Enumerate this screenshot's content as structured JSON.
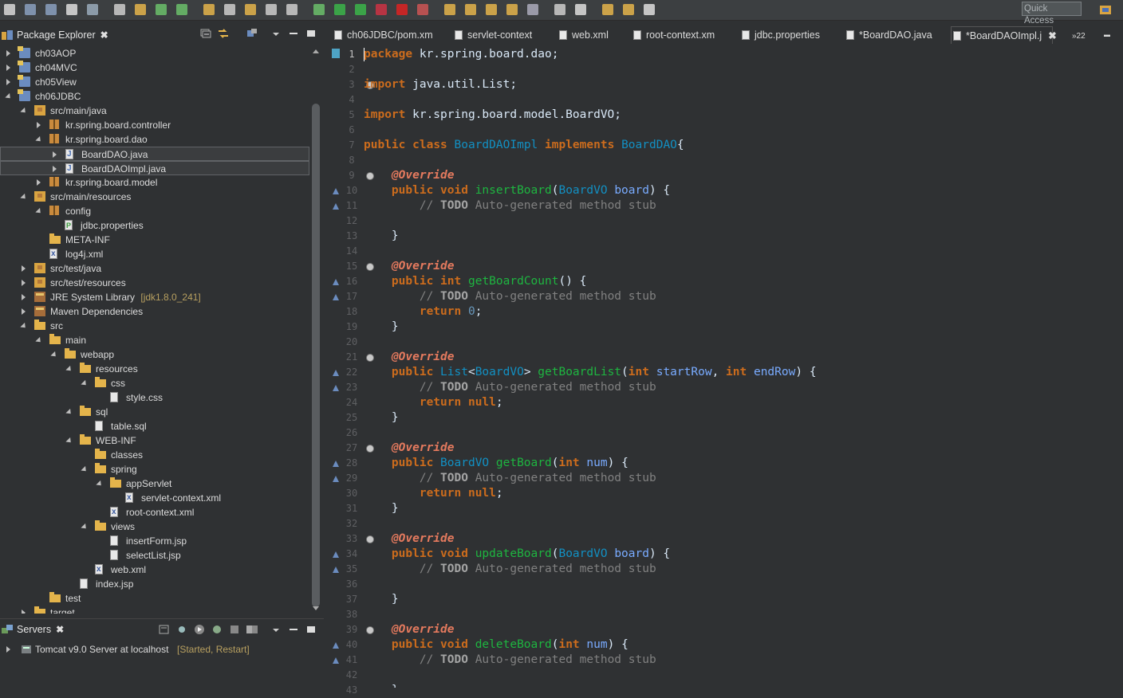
{
  "toolbar": {
    "quick_access": "Quick Access"
  },
  "package_explorer": {
    "title": "Package Explorer",
    "tree": [
      {
        "label": "ch03AOP",
        "indent": 0,
        "twisty": "collapsed",
        "icon": "project-icon"
      },
      {
        "label": "ch04MVC",
        "indent": 0,
        "twisty": "collapsed",
        "icon": "project-icon"
      },
      {
        "label": "ch05View",
        "indent": 0,
        "twisty": "collapsed",
        "icon": "project-icon"
      },
      {
        "label": "ch06JDBC",
        "indent": 0,
        "twisty": "expanded",
        "icon": "project-icon"
      },
      {
        "label": "src/main/java",
        "indent": 1,
        "twisty": "expanded",
        "icon": "source-folder-icon"
      },
      {
        "label": "kr.spring.board.controller",
        "indent": 2,
        "twisty": "collapsed",
        "icon": "package-icon"
      },
      {
        "label": "kr.spring.board.dao",
        "indent": 2,
        "twisty": "expanded",
        "icon": "package-icon"
      },
      {
        "label": "BoardDAO.java",
        "indent": 3,
        "twisty": "collapsed",
        "icon": "java-file-icon",
        "selected": true
      },
      {
        "label": "BoardDAOImpl.java",
        "indent": 3,
        "twisty": "collapsed",
        "icon": "java-file-icon",
        "selected": true
      },
      {
        "label": "kr.spring.board.model",
        "indent": 2,
        "twisty": "collapsed",
        "icon": "package-icon"
      },
      {
        "label": "src/main/resources",
        "indent": 1,
        "twisty": "expanded",
        "icon": "source-folder-icon"
      },
      {
        "label": "config",
        "indent": 2,
        "twisty": "expanded",
        "icon": "package-icon"
      },
      {
        "label": "jdbc.properties",
        "indent": 3,
        "twisty": "none",
        "icon": "properties-file-icon"
      },
      {
        "label": "META-INF",
        "indent": 2,
        "twisty": "none",
        "icon": "folder-icon"
      },
      {
        "label": "log4j.xml",
        "indent": 2,
        "twisty": "none",
        "icon": "xml-file-icon"
      },
      {
        "label": "src/test/java",
        "indent": 1,
        "twisty": "collapsed",
        "icon": "source-folder-icon"
      },
      {
        "label": "src/test/resources",
        "indent": 1,
        "twisty": "collapsed",
        "icon": "source-folder-icon"
      },
      {
        "label": "JRE System Library",
        "decoration": "[jdk1.8.0_241]",
        "indent": 1,
        "twisty": "collapsed",
        "icon": "library-icon"
      },
      {
        "label": "Maven Dependencies",
        "indent": 1,
        "twisty": "collapsed",
        "icon": "library-icon"
      },
      {
        "label": "src",
        "indent": 1,
        "twisty": "expanded",
        "icon": "folder-icon"
      },
      {
        "label": "main",
        "indent": 2,
        "twisty": "expanded",
        "icon": "folder-icon"
      },
      {
        "label": "webapp",
        "indent": 3,
        "twisty": "expanded",
        "icon": "folder-icon"
      },
      {
        "label": "resources",
        "indent": 4,
        "twisty": "expanded",
        "icon": "folder-icon"
      },
      {
        "label": "css",
        "indent": 5,
        "twisty": "expanded",
        "icon": "folder-icon"
      },
      {
        "label": "style.css",
        "indent": 6,
        "twisty": "none",
        "icon": "file-icon"
      },
      {
        "label": "sql",
        "indent": 4,
        "twisty": "expanded",
        "icon": "folder-icon"
      },
      {
        "label": "table.sql",
        "indent": 5,
        "twisty": "none",
        "icon": "file-icon"
      },
      {
        "label": "WEB-INF",
        "indent": 4,
        "twisty": "expanded",
        "icon": "folder-icon"
      },
      {
        "label": "classes",
        "indent": 5,
        "twisty": "none",
        "icon": "folder-icon"
      },
      {
        "label": "spring",
        "indent": 5,
        "twisty": "expanded",
        "icon": "folder-icon"
      },
      {
        "label": "appServlet",
        "indent": 6,
        "twisty": "expanded",
        "icon": "folder-icon"
      },
      {
        "label": "servlet-context.xml",
        "indent": 7,
        "twisty": "none",
        "icon": "xml-file-icon"
      },
      {
        "label": "root-context.xml",
        "indent": 6,
        "twisty": "none",
        "icon": "xml-file-icon"
      },
      {
        "label": "views",
        "indent": 5,
        "twisty": "expanded",
        "icon": "folder-icon"
      },
      {
        "label": "insertForm.jsp",
        "indent": 6,
        "twisty": "none",
        "icon": "file-icon"
      },
      {
        "label": "selectList.jsp",
        "indent": 6,
        "twisty": "none",
        "icon": "file-icon"
      },
      {
        "label": "web.xml",
        "indent": 5,
        "twisty": "none",
        "icon": "xml-file-icon"
      },
      {
        "label": "index.jsp",
        "indent": 4,
        "twisty": "none",
        "icon": "file-icon"
      },
      {
        "label": "test",
        "indent": 2,
        "twisty": "none",
        "icon": "folder-icon"
      },
      {
        "label": "target",
        "indent": 1,
        "twisty": "collapsed",
        "icon": "folder-icon"
      }
    ]
  },
  "servers": {
    "title": "Servers",
    "items": [
      {
        "label": "Tomcat v9.0 Server at localhost",
        "status": "[Started, Restart]"
      }
    ]
  },
  "editor": {
    "tabs": [
      {
        "label": "ch06JDBC/pom.xm",
        "active": false
      },
      {
        "label": "servlet-context",
        "active": false
      },
      {
        "label": "web.xml",
        "active": false
      },
      {
        "label": "root-context.xm",
        "active": false
      },
      {
        "label": "jdbc.properties",
        "active": false
      },
      {
        "label": "*BoardDAO.java",
        "active": false
      },
      {
        "label": "*BoardDAOImpl.j",
        "active": true
      }
    ],
    "overflow_label": "22",
    "current_line": 1,
    "code_lines": [
      [
        [
          "k",
          "package"
        ],
        [
          "tx",
          " kr.spring.board.dao;"
        ]
      ],
      [],
      [
        [
          "k",
          "import"
        ],
        [
          "tx",
          " java.util.List;"
        ]
      ],
      [],
      [
        [
          "k",
          "import"
        ],
        [
          "tx",
          " kr.spring.board.model.BoardVO;"
        ]
      ],
      [],
      [
        [
          "k",
          "public"
        ],
        [
          "tx",
          " "
        ],
        [
          "k",
          "class"
        ],
        [
          "tx",
          " "
        ],
        [
          "ty",
          "BoardDAOImpl"
        ],
        [
          "tx",
          " "
        ],
        [
          "k",
          "implements"
        ],
        [
          "tx",
          " "
        ],
        [
          "ty",
          "BoardDAO"
        ],
        [
          "tx",
          "{"
        ]
      ],
      [],
      [
        [
          "tx",
          "    "
        ],
        [
          "an",
          "@Override"
        ]
      ],
      [
        [
          "tx",
          "    "
        ],
        [
          "k",
          "public"
        ],
        [
          "tx",
          " "
        ],
        [
          "k",
          "void"
        ],
        [
          "tx",
          " "
        ],
        [
          "mt",
          "insertBoard"
        ],
        [
          "tx",
          "("
        ],
        [
          "ty",
          "BoardVO"
        ],
        [
          "tx",
          " "
        ],
        [
          "pn",
          "board"
        ],
        [
          "tx",
          ") {"
        ]
      ],
      [
        [
          "tx",
          "        "
        ],
        [
          "cm",
          "// "
        ],
        [
          "td",
          "TODO"
        ],
        [
          "cm",
          " Auto-generated method stub"
        ]
      ],
      [],
      [
        [
          "tx",
          "    }"
        ]
      ],
      [],
      [
        [
          "tx",
          "    "
        ],
        [
          "an",
          "@Override"
        ]
      ],
      [
        [
          "tx",
          "    "
        ],
        [
          "k",
          "public"
        ],
        [
          "tx",
          " "
        ],
        [
          "k",
          "int"
        ],
        [
          "tx",
          " "
        ],
        [
          "mt",
          "getBoardCount"
        ],
        [
          "tx",
          "() {"
        ]
      ],
      [
        [
          "tx",
          "        "
        ],
        [
          "cm",
          "// "
        ],
        [
          "td",
          "TODO"
        ],
        [
          "cm",
          " Auto-generated method stub"
        ]
      ],
      [
        [
          "tx",
          "        "
        ],
        [
          "k",
          "return"
        ],
        [
          "tx",
          " "
        ],
        [
          "nm",
          "0"
        ],
        [
          "tx",
          ";"
        ]
      ],
      [
        [
          "tx",
          "    }"
        ]
      ],
      [],
      [
        [
          "tx",
          "    "
        ],
        [
          "an",
          "@Override"
        ]
      ],
      [
        [
          "tx",
          "    "
        ],
        [
          "k",
          "public"
        ],
        [
          "tx",
          " "
        ],
        [
          "ty",
          "List"
        ],
        [
          "tx",
          "<"
        ],
        [
          "ty",
          "BoardVO"
        ],
        [
          "tx",
          "> "
        ],
        [
          "mt",
          "getBoardList"
        ],
        [
          "tx",
          "("
        ],
        [
          "k",
          "int"
        ],
        [
          "tx",
          " "
        ],
        [
          "pn",
          "startRow"
        ],
        [
          "tx",
          ", "
        ],
        [
          "k",
          "int"
        ],
        [
          "tx",
          " "
        ],
        [
          "pn",
          "endRow"
        ],
        [
          "tx",
          ") {"
        ]
      ],
      [
        [
          "tx",
          "        "
        ],
        [
          "cm",
          "// "
        ],
        [
          "td",
          "TODO"
        ],
        [
          "cm",
          " Auto-generated method stub"
        ]
      ],
      [
        [
          "tx",
          "        "
        ],
        [
          "k",
          "return"
        ],
        [
          "tx",
          " "
        ],
        [
          "k",
          "null"
        ],
        [
          "tx",
          ";"
        ]
      ],
      [
        [
          "tx",
          "    }"
        ]
      ],
      [],
      [
        [
          "tx",
          "    "
        ],
        [
          "an",
          "@Override"
        ]
      ],
      [
        [
          "tx",
          "    "
        ],
        [
          "k",
          "public"
        ],
        [
          "tx",
          " "
        ],
        [
          "ty",
          "BoardVO"
        ],
        [
          "tx",
          " "
        ],
        [
          "mt",
          "getBoard"
        ],
        [
          "tx",
          "("
        ],
        [
          "k",
          "int"
        ],
        [
          "tx",
          " "
        ],
        [
          "pn",
          "num"
        ],
        [
          "tx",
          ") {"
        ]
      ],
      [
        [
          "tx",
          "        "
        ],
        [
          "cm",
          "// "
        ],
        [
          "td",
          "TODO"
        ],
        [
          "cm",
          " Auto-generated method stub"
        ]
      ],
      [
        [
          "tx",
          "        "
        ],
        [
          "k",
          "return"
        ],
        [
          "tx",
          " "
        ],
        [
          "k",
          "null"
        ],
        [
          "tx",
          ";"
        ]
      ],
      [
        [
          "tx",
          "    }"
        ]
      ],
      [],
      [
        [
          "tx",
          "    "
        ],
        [
          "an",
          "@Override"
        ]
      ],
      [
        [
          "tx",
          "    "
        ],
        [
          "k",
          "public"
        ],
        [
          "tx",
          " "
        ],
        [
          "k",
          "void"
        ],
        [
          "tx",
          " "
        ],
        [
          "mt",
          "updateBoard"
        ],
        [
          "tx",
          "("
        ],
        [
          "ty",
          "BoardVO"
        ],
        [
          "tx",
          " "
        ],
        [
          "pn",
          "board"
        ],
        [
          "tx",
          ") {"
        ]
      ],
      [
        [
          "tx",
          "        "
        ],
        [
          "cm",
          "// "
        ],
        [
          "td",
          "TODO"
        ],
        [
          "cm",
          " Auto-generated method stub"
        ]
      ],
      [],
      [
        [
          "tx",
          "    }"
        ]
      ],
      [],
      [
        [
          "tx",
          "    "
        ],
        [
          "an",
          "@Override"
        ]
      ],
      [
        [
          "tx",
          "    "
        ],
        [
          "k",
          "public"
        ],
        [
          "tx",
          " "
        ],
        [
          "k",
          "void"
        ],
        [
          "tx",
          " "
        ],
        [
          "mt",
          "deleteBoard"
        ],
        [
          "tx",
          "("
        ],
        [
          "k",
          "int"
        ],
        [
          "tx",
          " "
        ],
        [
          "pn",
          "num"
        ],
        [
          "tx",
          ") {"
        ]
      ],
      [
        [
          "tx",
          "        "
        ],
        [
          "cm",
          "// "
        ],
        [
          "td",
          "TODO"
        ],
        [
          "cm",
          " Auto-generated method stub"
        ]
      ],
      [],
      [
        [
          "tx",
          "    }"
        ]
      ]
    ],
    "fold_lines": [
      3,
      9,
      15,
      21,
      27,
      33,
      39
    ],
    "override_marker_lines": [
      10,
      11,
      16,
      17,
      22,
      23,
      28,
      29,
      34,
      35,
      40,
      41
    ]
  },
  "colors": {
    "keyword": "#cc6c1d",
    "annotation": "#e57a5e",
    "type": "#1290c3",
    "method": "#1eb540",
    "comment": "#808080",
    "background": "#2f3133"
  }
}
